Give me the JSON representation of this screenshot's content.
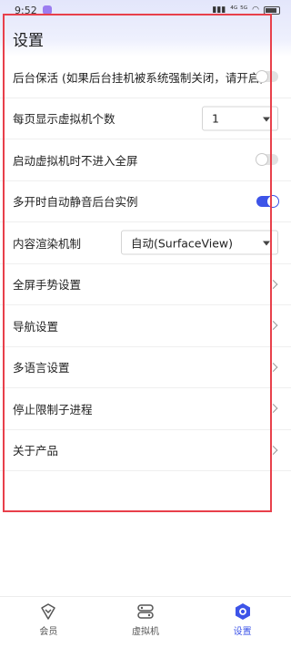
{
  "status_bar": {
    "time": "9:52",
    "indicators": "⁴ᴳ ⁵ᴳ"
  },
  "header": {
    "title": "设置"
  },
  "settings": [
    {
      "label": "后台保活 (如果后台挂机被系统强制关闭，请开启)",
      "type": "toggle",
      "on": false
    },
    {
      "label": "每页显示虚拟机个数",
      "type": "select",
      "value": "1"
    },
    {
      "label": "启动虚拟机时不进入全屏",
      "type": "toggle",
      "on": false
    },
    {
      "label": "多开时自动静音后台实例",
      "type": "toggle",
      "on": true
    },
    {
      "label": "内容渲染机制",
      "type": "select",
      "value": "自动(SurfaceView)"
    },
    {
      "label": "全屏手势设置",
      "type": "link"
    },
    {
      "label": "导航设置",
      "type": "link"
    },
    {
      "label": "多语言设置",
      "type": "link"
    },
    {
      "label": "停止限制子进程",
      "type": "link"
    },
    {
      "label": "关于产品",
      "type": "link"
    }
  ],
  "bottom_nav": [
    {
      "label": "会员",
      "icon": "vip-icon",
      "active": false
    },
    {
      "label": "虚拟机",
      "icon": "virtual-machine-icon",
      "active": false
    },
    {
      "label": "设置",
      "icon": "gear-icon",
      "active": true
    }
  ],
  "colors": {
    "accent": "#3d54e8",
    "highlight": "#e8404b",
    "header_bg": "#e3e6fb"
  }
}
